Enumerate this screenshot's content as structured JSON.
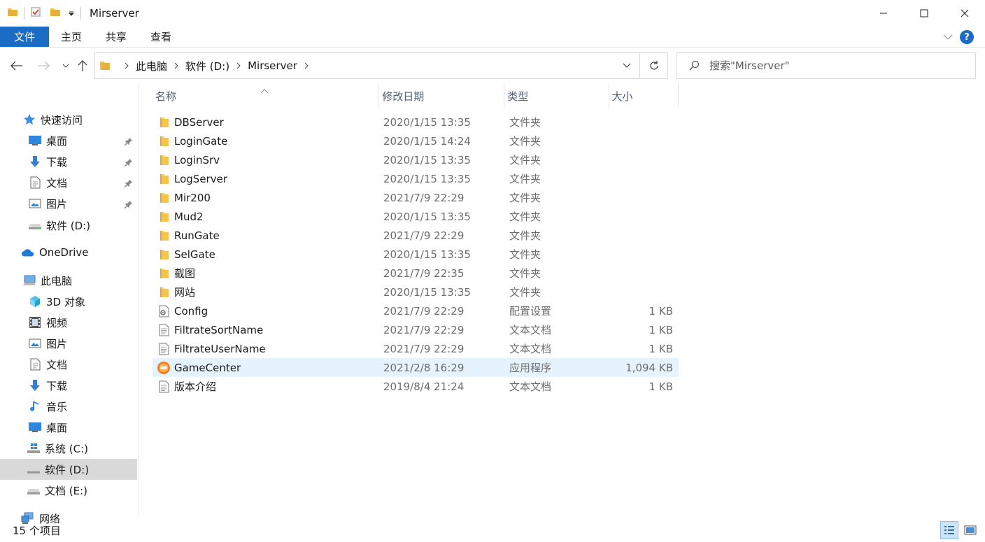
{
  "window": {
    "title": "Mirserver"
  },
  "ribbon": {
    "tabs": [
      "文件",
      "主页",
      "共享",
      "查看"
    ],
    "help": "?"
  },
  "address": {
    "crumbs": [
      "此电脑",
      "软件 (D:)",
      "Mirserver"
    ]
  },
  "search": {
    "placeholder": "搜索\"Mirserver\""
  },
  "sidebar": {
    "items": [
      {
        "label": "快速访问",
        "icon": "star-icon"
      },
      {
        "label": "桌面",
        "icon": "desktop-icon",
        "pinned": true
      },
      {
        "label": "下载",
        "icon": "download-icon",
        "pinned": true
      },
      {
        "label": "文档",
        "icon": "document-icon",
        "pinned": true
      },
      {
        "label": "图片",
        "icon": "picture-icon",
        "pinned": true
      },
      {
        "label": "软件 (D:)",
        "icon": "drive-icon"
      },
      {
        "label": "OneDrive",
        "icon": "cloud-icon"
      },
      {
        "label": "此电脑",
        "icon": "computer-icon"
      },
      {
        "label": "3D 对象",
        "icon": "cube-icon"
      },
      {
        "label": "视频",
        "icon": "video-icon"
      },
      {
        "label": "图片",
        "icon": "picture-icon"
      },
      {
        "label": "文档",
        "icon": "document-icon"
      },
      {
        "label": "下载",
        "icon": "download-icon"
      },
      {
        "label": "音乐",
        "icon": "music-icon"
      },
      {
        "label": "桌面",
        "icon": "desktop-icon"
      },
      {
        "label": "系统 (C:)",
        "icon": "windows-drive-icon"
      },
      {
        "label": "软件 (D:)",
        "icon": "drive-icon",
        "selected": true
      },
      {
        "label": "文档 (E:)",
        "icon": "drive-icon"
      },
      {
        "label": "网络",
        "icon": "network-icon"
      }
    ]
  },
  "columns": [
    "名称",
    "修改日期",
    "类型",
    "大小"
  ],
  "files": [
    {
      "name": "DBServer",
      "date": "2020/1/15 13:35",
      "type": "文件夹",
      "size": "",
      "icon": "folder-icon"
    },
    {
      "name": "LoginGate",
      "date": "2020/1/15 14:24",
      "type": "文件夹",
      "size": "",
      "icon": "folder-icon"
    },
    {
      "name": "LoginSrv",
      "date": "2020/1/15 13:35",
      "type": "文件夹",
      "size": "",
      "icon": "folder-icon"
    },
    {
      "name": "LogServer",
      "date": "2020/1/15 13:35",
      "type": "文件夹",
      "size": "",
      "icon": "folder-icon"
    },
    {
      "name": "Mir200",
      "date": "2021/7/9 22:29",
      "type": "文件夹",
      "size": "",
      "icon": "folder-icon"
    },
    {
      "name": "Mud2",
      "date": "2020/1/15 13:35",
      "type": "文件夹",
      "size": "",
      "icon": "folder-icon"
    },
    {
      "name": "RunGate",
      "date": "2021/7/9 22:29",
      "type": "文件夹",
      "size": "",
      "icon": "folder-icon"
    },
    {
      "name": "SelGate",
      "date": "2020/1/15 13:35",
      "type": "文件夹",
      "size": "",
      "icon": "folder-icon"
    },
    {
      "name": "截图",
      "date": "2021/7/9 22:35",
      "type": "文件夹",
      "size": "",
      "icon": "folder-icon"
    },
    {
      "name": "网站",
      "date": "2020/1/15 13:35",
      "type": "文件夹",
      "size": "",
      "icon": "folder-icon"
    },
    {
      "name": "Config",
      "date": "2021/7/9 22:29",
      "type": "配置设置",
      "size": "1 KB",
      "icon": "config-file-icon"
    },
    {
      "name": "FiltrateSortName",
      "date": "2021/7/9 22:29",
      "type": "文本文档",
      "size": "1 KB",
      "icon": "text-file-icon"
    },
    {
      "name": "FiltrateUserName",
      "date": "2021/7/9 22:29",
      "type": "文本文档",
      "size": "1 KB",
      "icon": "text-file-icon"
    },
    {
      "name": "GameCenter",
      "date": "2021/2/8 16:29",
      "type": "应用程序",
      "size": "1,094 KB",
      "icon": "app-icon",
      "hover": true
    },
    {
      "name": "版本介绍",
      "date": "2019/8/4 21:24",
      "type": "文本文档",
      "size": "1 KB",
      "icon": "text-file-icon"
    }
  ],
  "status": {
    "count": "15 个项目"
  },
  "colors": {
    "accent": "#1a6cc4",
    "folder": "#f3c44e",
    "hover": "#e5f3ff",
    "selected": "#d9d9d9"
  }
}
